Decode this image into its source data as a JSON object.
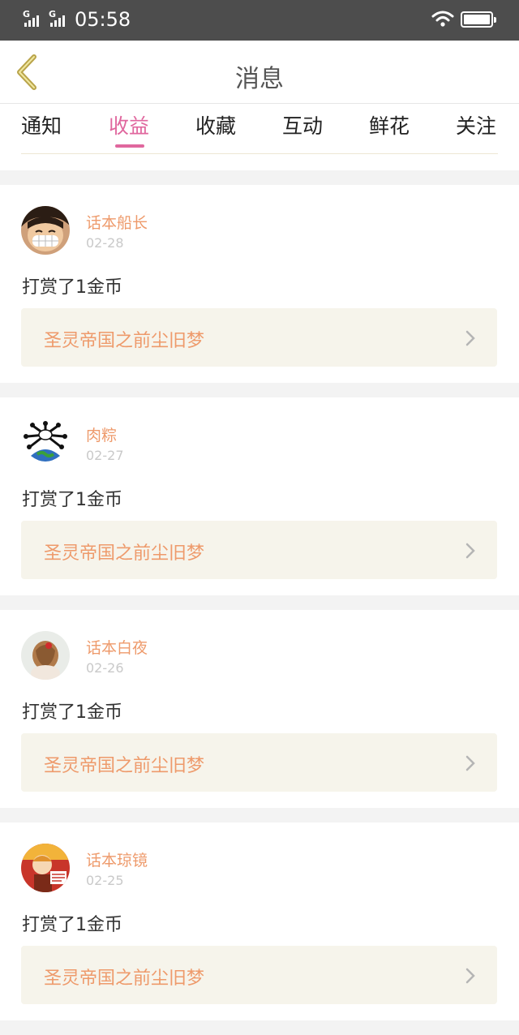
{
  "status_bar": {
    "signal1_label": "G",
    "signal2_label": "G",
    "time": "05:58"
  },
  "header": {
    "title": "消息"
  },
  "tabs": [
    {
      "label": "通知",
      "active": false
    },
    {
      "label": "收益",
      "active": true
    },
    {
      "label": "收藏",
      "active": false
    },
    {
      "label": "互动",
      "active": false
    },
    {
      "label": "鲜花",
      "active": false
    },
    {
      "label": "关注",
      "active": false
    }
  ],
  "messages": [
    {
      "user": "话本船长",
      "date": "02-28",
      "text": "打赏了1金币",
      "book": "圣灵帝国之前尘旧梦",
      "avatar": "luffy-avatar"
    },
    {
      "user": "肉粽",
      "date": "02-27",
      "text": "打赏了1金币",
      "book": "圣灵帝国之前尘旧梦",
      "avatar": "earth-avatar"
    },
    {
      "user": "话本白夜",
      "date": "02-26",
      "text": "打赏了1金币",
      "book": "圣灵帝国之前尘旧梦",
      "avatar": "girl-avatar"
    },
    {
      "user": "话本琼镜",
      "date": "02-25",
      "text": "打赏了1金币",
      "book": "圣灵帝国之前尘旧梦",
      "avatar": "cartoon-avatar"
    }
  ],
  "colors": {
    "accent_pink": "#e0679e",
    "username_orange": "#ee9a6b",
    "back_arrow": "#b9a44a",
    "link_bg": "#f6f4eb"
  }
}
